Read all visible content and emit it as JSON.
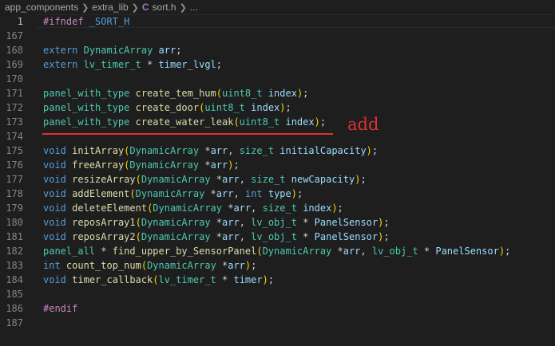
{
  "breadcrumb": {
    "part1": "app_components",
    "part2": "extra_lib",
    "file_icon": "C",
    "part3": "sort.h",
    "part4": "..."
  },
  "lines": [
    {
      "num": "1",
      "tokens": [
        [
          "pp",
          "#ifndef"
        ],
        [
          "",
          ""
        ],
        [
          "mc",
          " _SORT_H"
        ]
      ]
    },
    {
      "num": "167",
      "tokens": []
    },
    {
      "num": "168",
      "tokens": [
        [
          "kw",
          "extern"
        ],
        [
          "",
          " "
        ],
        [
          "ty",
          "DynamicArray"
        ],
        [
          "",
          " "
        ],
        [
          "pm",
          "arr"
        ],
        [
          "",
          ";"
        ]
      ]
    },
    {
      "num": "169",
      "tokens": [
        [
          "kw",
          "extern"
        ],
        [
          "",
          " "
        ],
        [
          "ty",
          "lv_timer_t"
        ],
        [
          "",
          " * "
        ],
        [
          "pm",
          "timer_lvgl"
        ],
        [
          "",
          ";"
        ]
      ]
    },
    {
      "num": "170",
      "tokens": []
    },
    {
      "num": "171",
      "tokens": [
        [
          "ty",
          "panel_with_type"
        ],
        [
          "",
          " "
        ],
        [
          "fn",
          "create_tem_hum"
        ],
        [
          "pun",
          "("
        ],
        [
          "ty",
          "uint8_t"
        ],
        [
          "",
          " "
        ],
        [
          "pm",
          "index"
        ],
        [
          "pun",
          ")"
        ],
        [
          "",
          ";"
        ]
      ]
    },
    {
      "num": "172",
      "tokens": [
        [
          "ty",
          "panel_with_type"
        ],
        [
          "",
          " "
        ],
        [
          "fn",
          "create_door"
        ],
        [
          "pun",
          "("
        ],
        [
          "ty",
          "uint8_t"
        ],
        [
          "",
          " "
        ],
        [
          "pm",
          "index"
        ],
        [
          "pun",
          ")"
        ],
        [
          "",
          ";"
        ]
      ]
    },
    {
      "num": "173",
      "tokens": [
        [
          "ty",
          "panel_with_type"
        ],
        [
          "",
          " "
        ],
        [
          "fn",
          "create_water_leak"
        ],
        [
          "pun",
          "("
        ],
        [
          "ty",
          "uint8_t"
        ],
        [
          "",
          " "
        ],
        [
          "pm",
          "index"
        ],
        [
          "pun",
          ")"
        ],
        [
          "",
          ";"
        ]
      ]
    },
    {
      "num": "174",
      "tokens": []
    },
    {
      "num": "175",
      "tokens": [
        [
          "kw",
          "void"
        ],
        [
          "",
          " "
        ],
        [
          "fn",
          "initArray"
        ],
        [
          "pun",
          "("
        ],
        [
          "ty",
          "DynamicArray"
        ],
        [
          "",
          " *"
        ],
        [
          "pm",
          "arr"
        ],
        [
          "",
          ", "
        ],
        [
          "ty",
          "size_t"
        ],
        [
          "",
          " "
        ],
        [
          "pm",
          "initialCapacity"
        ],
        [
          "pun",
          ")"
        ],
        [
          "",
          ";"
        ]
      ]
    },
    {
      "num": "176",
      "tokens": [
        [
          "kw",
          "void"
        ],
        [
          "",
          " "
        ],
        [
          "fn",
          "freeArray"
        ],
        [
          "pun",
          "("
        ],
        [
          "ty",
          "DynamicArray"
        ],
        [
          "",
          " *"
        ],
        [
          "pm",
          "arr"
        ],
        [
          "pun",
          ")"
        ],
        [
          "",
          ";"
        ]
      ]
    },
    {
      "num": "177",
      "tokens": [
        [
          "kw",
          "void"
        ],
        [
          "",
          " "
        ],
        [
          "fn",
          "resizeArray"
        ],
        [
          "pun",
          "("
        ],
        [
          "ty",
          "DynamicArray"
        ],
        [
          "",
          " *"
        ],
        [
          "pm",
          "arr"
        ],
        [
          "",
          ", "
        ],
        [
          "ty",
          "size_t"
        ],
        [
          "",
          " "
        ],
        [
          "pm",
          "newCapacity"
        ],
        [
          "pun",
          ")"
        ],
        [
          "",
          ";"
        ]
      ]
    },
    {
      "num": "178",
      "tokens": [
        [
          "kw",
          "void"
        ],
        [
          "",
          " "
        ],
        [
          "fn",
          "addElement"
        ],
        [
          "pun",
          "("
        ],
        [
          "ty",
          "DynamicArray"
        ],
        [
          "",
          " *"
        ],
        [
          "pm",
          "arr"
        ],
        [
          "",
          ", "
        ],
        [
          "kw",
          "int"
        ],
        [
          "",
          " "
        ],
        [
          "pm",
          "type"
        ],
        [
          "pun",
          ")"
        ],
        [
          "",
          ";"
        ]
      ]
    },
    {
      "num": "179",
      "tokens": [
        [
          "kw",
          "void"
        ],
        [
          "",
          " "
        ],
        [
          "fn",
          "deleteElement"
        ],
        [
          "pun",
          "("
        ],
        [
          "ty",
          "DynamicArray"
        ],
        [
          "",
          " *"
        ],
        [
          "pm",
          "arr"
        ],
        [
          "",
          ", "
        ],
        [
          "ty",
          "size_t"
        ],
        [
          "",
          " "
        ],
        [
          "pm",
          "index"
        ],
        [
          "pun",
          ")"
        ],
        [
          "",
          ";"
        ]
      ]
    },
    {
      "num": "180",
      "tokens": [
        [
          "kw",
          "void"
        ],
        [
          "",
          " "
        ],
        [
          "fn",
          "reposArray1"
        ],
        [
          "pun",
          "("
        ],
        [
          "ty",
          "DynamicArray"
        ],
        [
          "",
          " *"
        ],
        [
          "pm",
          "arr"
        ],
        [
          "",
          ", "
        ],
        [
          "ty",
          "lv_obj_t"
        ],
        [
          "",
          " * "
        ],
        [
          "pm",
          "PanelSensor"
        ],
        [
          "pun",
          ")"
        ],
        [
          "",
          ";"
        ]
      ]
    },
    {
      "num": "181",
      "tokens": [
        [
          "kw",
          "void"
        ],
        [
          "",
          " "
        ],
        [
          "fn",
          "reposArray2"
        ],
        [
          "pun",
          "("
        ],
        [
          "ty",
          "DynamicArray"
        ],
        [
          "",
          " *"
        ],
        [
          "pm",
          "arr"
        ],
        [
          "",
          ", "
        ],
        [
          "ty",
          "lv_obj_t"
        ],
        [
          "",
          " * "
        ],
        [
          "pm",
          "PanelSensor"
        ],
        [
          "pun",
          ")"
        ],
        [
          "",
          ";"
        ]
      ]
    },
    {
      "num": "182",
      "tokens": [
        [
          "ty",
          "panel_all"
        ],
        [
          "",
          " * "
        ],
        [
          "fn",
          "find_upper_by_SensorPanel"
        ],
        [
          "pun",
          "("
        ],
        [
          "ty",
          "DynamicArray"
        ],
        [
          "",
          " *"
        ],
        [
          "pm",
          "arr"
        ],
        [
          "",
          ", "
        ],
        [
          "ty",
          "lv_obj_t"
        ],
        [
          "",
          " * "
        ],
        [
          "pm",
          "PanelSensor"
        ],
        [
          "pun",
          ")"
        ],
        [
          "",
          ";"
        ]
      ]
    },
    {
      "num": "183",
      "tokens": [
        [
          "kw",
          "int"
        ],
        [
          "",
          " "
        ],
        [
          "fn",
          "count_top_num"
        ],
        [
          "pun",
          "("
        ],
        [
          "ty",
          "DynamicArray"
        ],
        [
          "",
          " *"
        ],
        [
          "pm",
          "arr"
        ],
        [
          "pun",
          ")"
        ],
        [
          "",
          ";"
        ]
      ]
    },
    {
      "num": "184",
      "tokens": [
        [
          "kw",
          "void"
        ],
        [
          "",
          " "
        ],
        [
          "fn",
          "timer_callback"
        ],
        [
          "pun",
          "("
        ],
        [
          "ty",
          "lv_timer_t"
        ],
        [
          "",
          " * "
        ],
        [
          "pm",
          "timer"
        ],
        [
          "pun",
          ")"
        ],
        [
          "",
          ";"
        ]
      ]
    },
    {
      "num": "185",
      "tokens": []
    },
    {
      "num": "186",
      "tokens": [
        [
          "pp",
          "#endif"
        ]
      ]
    },
    {
      "num": "187",
      "tokens": []
    }
  ],
  "annotation": "add",
  "colors": {
    "background": "#1e1e1e",
    "annotation_red": "#e0312f"
  }
}
